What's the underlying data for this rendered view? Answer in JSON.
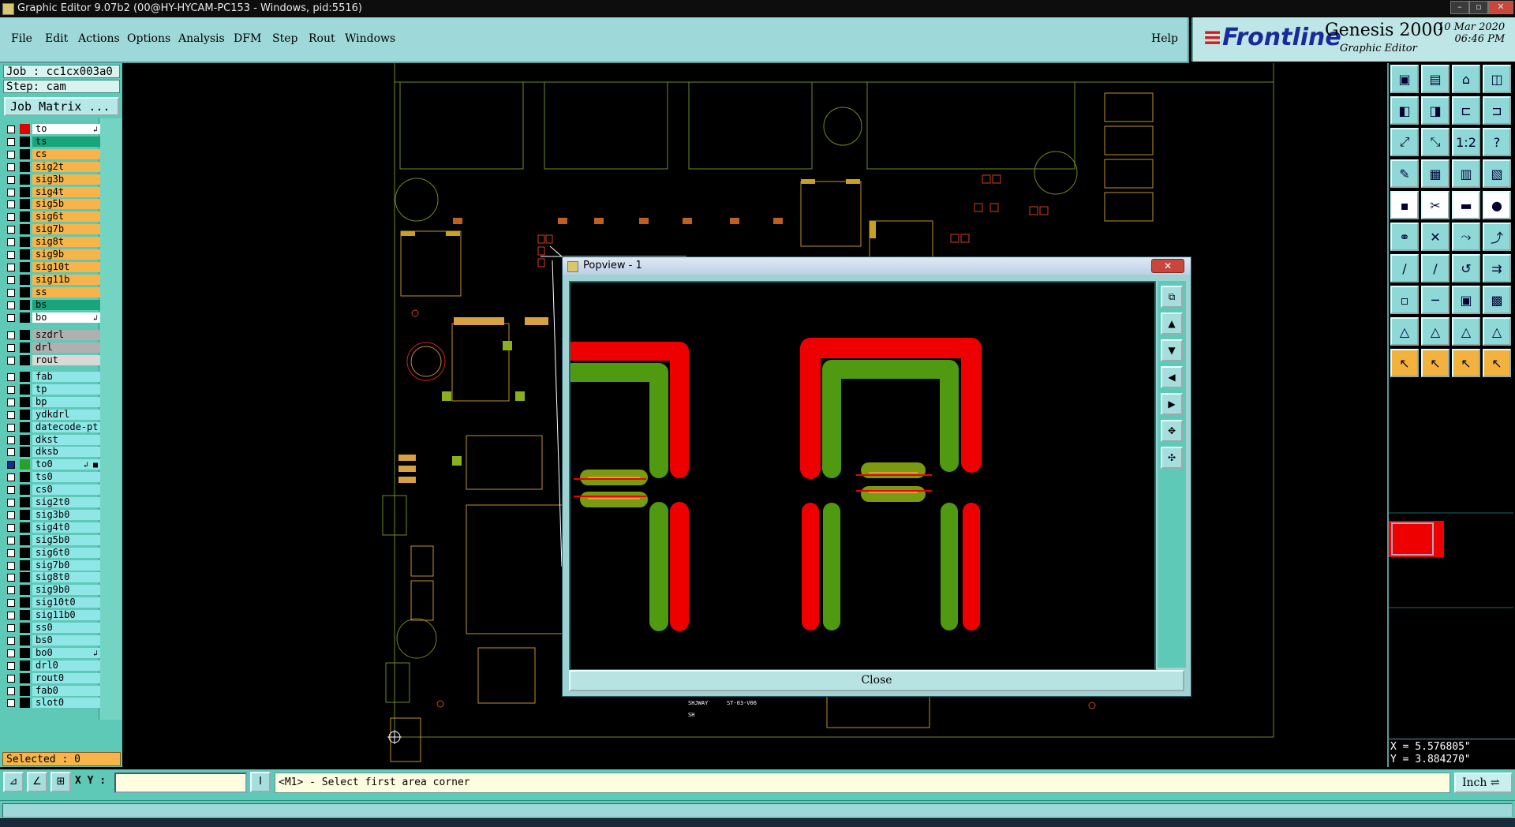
{
  "window": {
    "title": "Graphic Editor 9.07b2 (00@HY-HYCAM-PC153 - Windows, pid:5516)"
  },
  "menu": {
    "items": [
      "File",
      "Edit",
      "Actions",
      "Options",
      "Analysis",
      "DFM",
      "Step",
      "Rout",
      "Windows"
    ],
    "help": "Help"
  },
  "brand": {
    "logo": "Frontline",
    "product": "Genesis 2000",
    "subtitle": "Graphic Editor",
    "date": "10 Mar 2020",
    "time": "06:46 PM"
  },
  "job": {
    "job_line": "Job : cc1cx003a0",
    "step_line": "Step: cam",
    "matrix_button": "Job Matrix ..."
  },
  "layers_group1": [
    {
      "name": "to",
      "bg": "#ffffff",
      "swatch": "#e00000",
      "mark": "↲"
    },
    {
      "name": "ts",
      "bg": "#19a47c",
      "swatch": "#000000",
      "mark": ""
    },
    {
      "name": "cs",
      "bg": "#f6b44a",
      "swatch": "#000000",
      "mark": ""
    },
    {
      "name": "sig2t",
      "bg": "#f6b44a",
      "swatch": "#000000",
      "mark": ""
    },
    {
      "name": "sig3b",
      "bg": "#f6b44a",
      "swatch": "#000000",
      "mark": ""
    },
    {
      "name": "sig4t",
      "bg": "#f6b44a",
      "swatch": "#000000",
      "mark": ""
    },
    {
      "name": "sig5b",
      "bg": "#f6b44a",
      "swatch": "#000000",
      "mark": ""
    },
    {
      "name": "sig6t",
      "bg": "#f6b44a",
      "swatch": "#000000",
      "mark": ""
    },
    {
      "name": "sig7b",
      "bg": "#f6b44a",
      "swatch": "#000000",
      "mark": ""
    },
    {
      "name": "sig8t",
      "bg": "#f6b44a",
      "swatch": "#000000",
      "mark": ""
    },
    {
      "name": "sig9b",
      "bg": "#f6b44a",
      "swatch": "#000000",
      "mark": ""
    },
    {
      "name": "sig10t",
      "bg": "#f6b44a",
      "swatch": "#000000",
      "mark": ""
    },
    {
      "name": "sig11b",
      "bg": "#f6b44a",
      "swatch": "#000000",
      "mark": ""
    },
    {
      "name": "ss",
      "bg": "#f6b44a",
      "swatch": "#000000",
      "mark": ""
    },
    {
      "name": "bs",
      "bg": "#19a47c",
      "swatch": "#000000",
      "mark": ""
    },
    {
      "name": "bo",
      "bg": "#ffffff",
      "swatch": "#000000",
      "mark": "↲"
    }
  ],
  "layers_group2": [
    {
      "name": "szdrl",
      "bg": "#b0b0b0",
      "swatch": "#000000",
      "mark": ""
    },
    {
      "name": "drl",
      "bg": "#b0b0b0",
      "swatch": "#000000",
      "mark": ""
    },
    {
      "name": "rout",
      "bg": "#d8d8d8",
      "swatch": "#000000",
      "mark": ""
    }
  ],
  "layers_group3": [
    {
      "name": "fab",
      "bg": "#8ee6e6",
      "swatch": "#000000",
      "mark": ""
    },
    {
      "name": "tp",
      "bg": "#8ee6e6",
      "swatch": "#000000",
      "mark": ""
    },
    {
      "name": "bp",
      "bg": "#8ee6e6",
      "swatch": "#000000",
      "mark": ""
    },
    {
      "name": "ydkdrl",
      "bg": "#8ee6e6",
      "swatch": "#000000",
      "mark": ""
    },
    {
      "name": "datecode-pt",
      "bg": "#8ee6e6",
      "swatch": "#000000",
      "mark": ""
    },
    {
      "name": "dkst",
      "bg": "#8ee6e6",
      "swatch": "#000000",
      "mark": ""
    },
    {
      "name": "dksb",
      "bg": "#8ee6e6",
      "swatch": "#000000",
      "mark": ""
    },
    {
      "name": "to0",
      "bg": "#8ee6e6",
      "swatch": "#2aa02a",
      "mark": "↲ ■"
    },
    {
      "name": "ts0",
      "bg": "#8ee6e6",
      "swatch": "#000000",
      "mark": ""
    },
    {
      "name": "cs0",
      "bg": "#8ee6e6",
      "swatch": "#000000",
      "mark": ""
    },
    {
      "name": "sig2t0",
      "bg": "#8ee6e6",
      "swatch": "#000000",
      "mark": ""
    },
    {
      "name": "sig3b0",
      "bg": "#8ee6e6",
      "swatch": "#000000",
      "mark": ""
    },
    {
      "name": "sig4t0",
      "bg": "#8ee6e6",
      "swatch": "#000000",
      "mark": ""
    },
    {
      "name": "sig5b0",
      "bg": "#8ee6e6",
      "swatch": "#000000",
      "mark": ""
    },
    {
      "name": "sig6t0",
      "bg": "#8ee6e6",
      "swatch": "#000000",
      "mark": ""
    },
    {
      "name": "sig7b0",
      "bg": "#8ee6e6",
      "swatch": "#000000",
      "mark": ""
    },
    {
      "name": "sig8t0",
      "bg": "#8ee6e6",
      "swatch": "#000000",
      "mark": ""
    },
    {
      "name": "sig9b0",
      "bg": "#8ee6e6",
      "swatch": "#000000",
      "mark": ""
    },
    {
      "name": "sig10t0",
      "bg": "#8ee6e6",
      "swatch": "#000000",
      "mark": ""
    },
    {
      "name": "sig11b0",
      "bg": "#8ee6e6",
      "swatch": "#000000",
      "mark": ""
    },
    {
      "name": "ss0",
      "bg": "#8ee6e6",
      "swatch": "#000000",
      "mark": ""
    },
    {
      "name": "bs0",
      "bg": "#8ee6e6",
      "swatch": "#000000",
      "mark": ""
    },
    {
      "name": "bo0",
      "bg": "#8ee6e6",
      "swatch": "#000000",
      "mark": "↲"
    },
    {
      "name": "drl0",
      "bg": "#8ee6e6",
      "swatch": "#000000",
      "mark": ""
    },
    {
      "name": "rout0",
      "bg": "#8ee6e6",
      "swatch": "#000000",
      "mark": ""
    },
    {
      "name": "fab0",
      "bg": "#8ee6e6",
      "swatch": "#000000",
      "mark": ""
    },
    {
      "name": "slot0",
      "bg": "#8ee6e6",
      "swatch": "#000000",
      "mark": ""
    }
  ],
  "status": {
    "selected": "Selected : 0",
    "xy_label": "X Y :",
    "xy_value": "",
    "message": "<M1> - Select first area corner",
    "unit": "Inch"
  },
  "coords": {
    "x": "X = 5.576805\"",
    "y": "Y = 3.884270\""
  },
  "popview": {
    "title": "Popview - 1",
    "close": "Close"
  },
  "board_text": [
    "SHJWAY",
    "ST-03-V06",
    "SH"
  ],
  "colors": {
    "panel": "#5ec9b6",
    "menubar": "#9ed8d8",
    "signal_top": "#e00000",
    "signal_other": "#4f9a10",
    "outline": "#6b8a2a"
  },
  "tool_icons": [
    "open-job-icon",
    "save-icon",
    "home-icon",
    "split-view-icon",
    "zoom-prev-icon",
    "zoom-next-icon",
    "pan-icon",
    "redraw-icon",
    "zoom-fit-icon",
    "zoom-center-icon",
    "scale-1-2-icon",
    "help-icon",
    "snap-icon",
    "grid-icon",
    "layer-add-icon",
    "layer-remove-icon",
    "pad-add-icon",
    "cut-icon",
    "measure-icon",
    "circle-icon",
    "connect-icon",
    "delete-icon",
    "move-node-icon",
    "move-end-icon",
    "line-add-icon",
    "line-draw-icon",
    "arc-icon",
    "parallel-icon",
    "select-icon",
    "edge-icon",
    "contour-icon",
    "shapes-icon",
    "triangle-add-icon",
    "triangle-edit-icon",
    "triangle-node-icon",
    "triangle-move-icon",
    "pointer-icon",
    "pointer-add-icon",
    "pointer-node-icon",
    "pointer-route-icon"
  ]
}
